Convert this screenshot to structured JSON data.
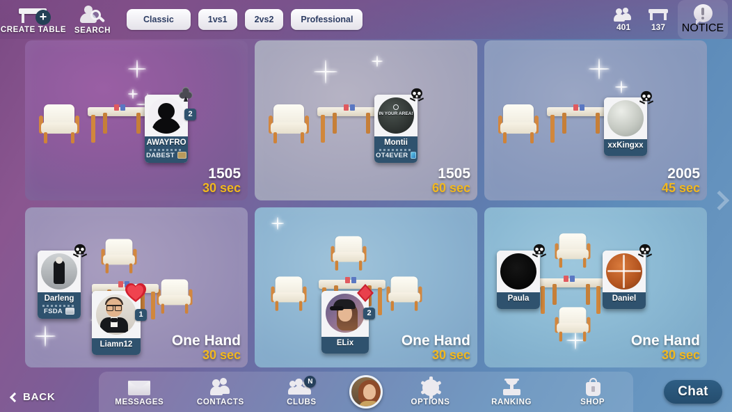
{
  "header": {
    "create_table_label": "CREATE TABLE",
    "search_label": "SEARCH",
    "filters": [
      {
        "label": "Classic",
        "active": true
      },
      {
        "label": "1vs1",
        "active": false
      },
      {
        "label": "2vs2",
        "active": false
      },
      {
        "label": "Professional",
        "active": false
      }
    ],
    "players_online": "401",
    "tables_open": "137",
    "notice_label": "NOTICE"
  },
  "tables": [
    {
      "id": "table-1",
      "theme": "tc-purple",
      "score": "1505",
      "time": "30 sec",
      "seats": 2,
      "players": [
        {
          "name": "AWAYFRO",
          "club": "DABEST",
          "avatar": "silhouette",
          "badge": "club-suit",
          "badge_count": "2",
          "club_flag": "gold"
        }
      ]
    },
    {
      "id": "table-2",
      "theme": "tc-gray",
      "score": "1505",
      "time": "60 sec",
      "seats": 2,
      "players": [
        {
          "name": "Montii",
          "club": "OT4EVER",
          "avatar": "dark-disc",
          "avatar_text": "IN YOUR AREA!",
          "badge": "skull",
          "club_flag": "blue"
        }
      ]
    },
    {
      "id": "table-3",
      "theme": "tc-steel",
      "score": "2005",
      "time": "45 sec",
      "seats": 2,
      "players": [
        {
          "name": "xxKingxx",
          "club": "",
          "avatar": "sphere",
          "badge": "skull"
        }
      ]
    },
    {
      "id": "table-4",
      "theme": "tc-violet",
      "score": "One Hand",
      "time": "30 sec",
      "seats": 4,
      "players": [
        {
          "name": "Darleng",
          "club": "FSDA",
          "avatar": "bw-person",
          "badge": "skull",
          "club_flag": "gray"
        },
        {
          "name": "Liamn12",
          "club": "",
          "avatar": "suit-man",
          "badge": "heart-suit",
          "badge_count": "1"
        }
      ]
    },
    {
      "id": "table-5",
      "theme": "tc-sky",
      "score": "One Hand",
      "time": "30 sec",
      "seats": 4,
      "players": [
        {
          "name": "ELix",
          "club": "",
          "avatar": "girl-cap",
          "badge": "diamond-suit",
          "badge_count": "2"
        }
      ]
    },
    {
      "id": "table-6",
      "theme": "tc-sky2",
      "score": "One Hand",
      "time": "30 sec",
      "seats": 4,
      "players": [
        {
          "name": "Paula",
          "club": "",
          "avatar": "black-disc",
          "badge": "skull"
        },
        {
          "name": "Daniel",
          "club": "",
          "avatar": "basketball",
          "badge": "skull"
        }
      ]
    }
  ],
  "bottom": {
    "back_label": "BACK",
    "nav": [
      {
        "label": "MESSAGES",
        "icon": "envelope-icon",
        "badge": ""
      },
      {
        "label": "CONTACTS",
        "icon": "contacts-icon",
        "badge": ""
      },
      {
        "label": "CLUBS",
        "icon": "clubs-icon",
        "badge": "N"
      },
      {
        "label": "OPTIONS",
        "icon": "gear-icon",
        "badge": ""
      },
      {
        "label": "RANKING",
        "icon": "trophy-icon",
        "badge": ""
      },
      {
        "label": "SHOP",
        "icon": "shop-bag-icon",
        "badge": ""
      }
    ],
    "chat_label": "Chat"
  },
  "colors": {
    "accent_time": "#f2b81e",
    "nameplate": "#2f526e",
    "chip_text": "#2d3d63"
  }
}
